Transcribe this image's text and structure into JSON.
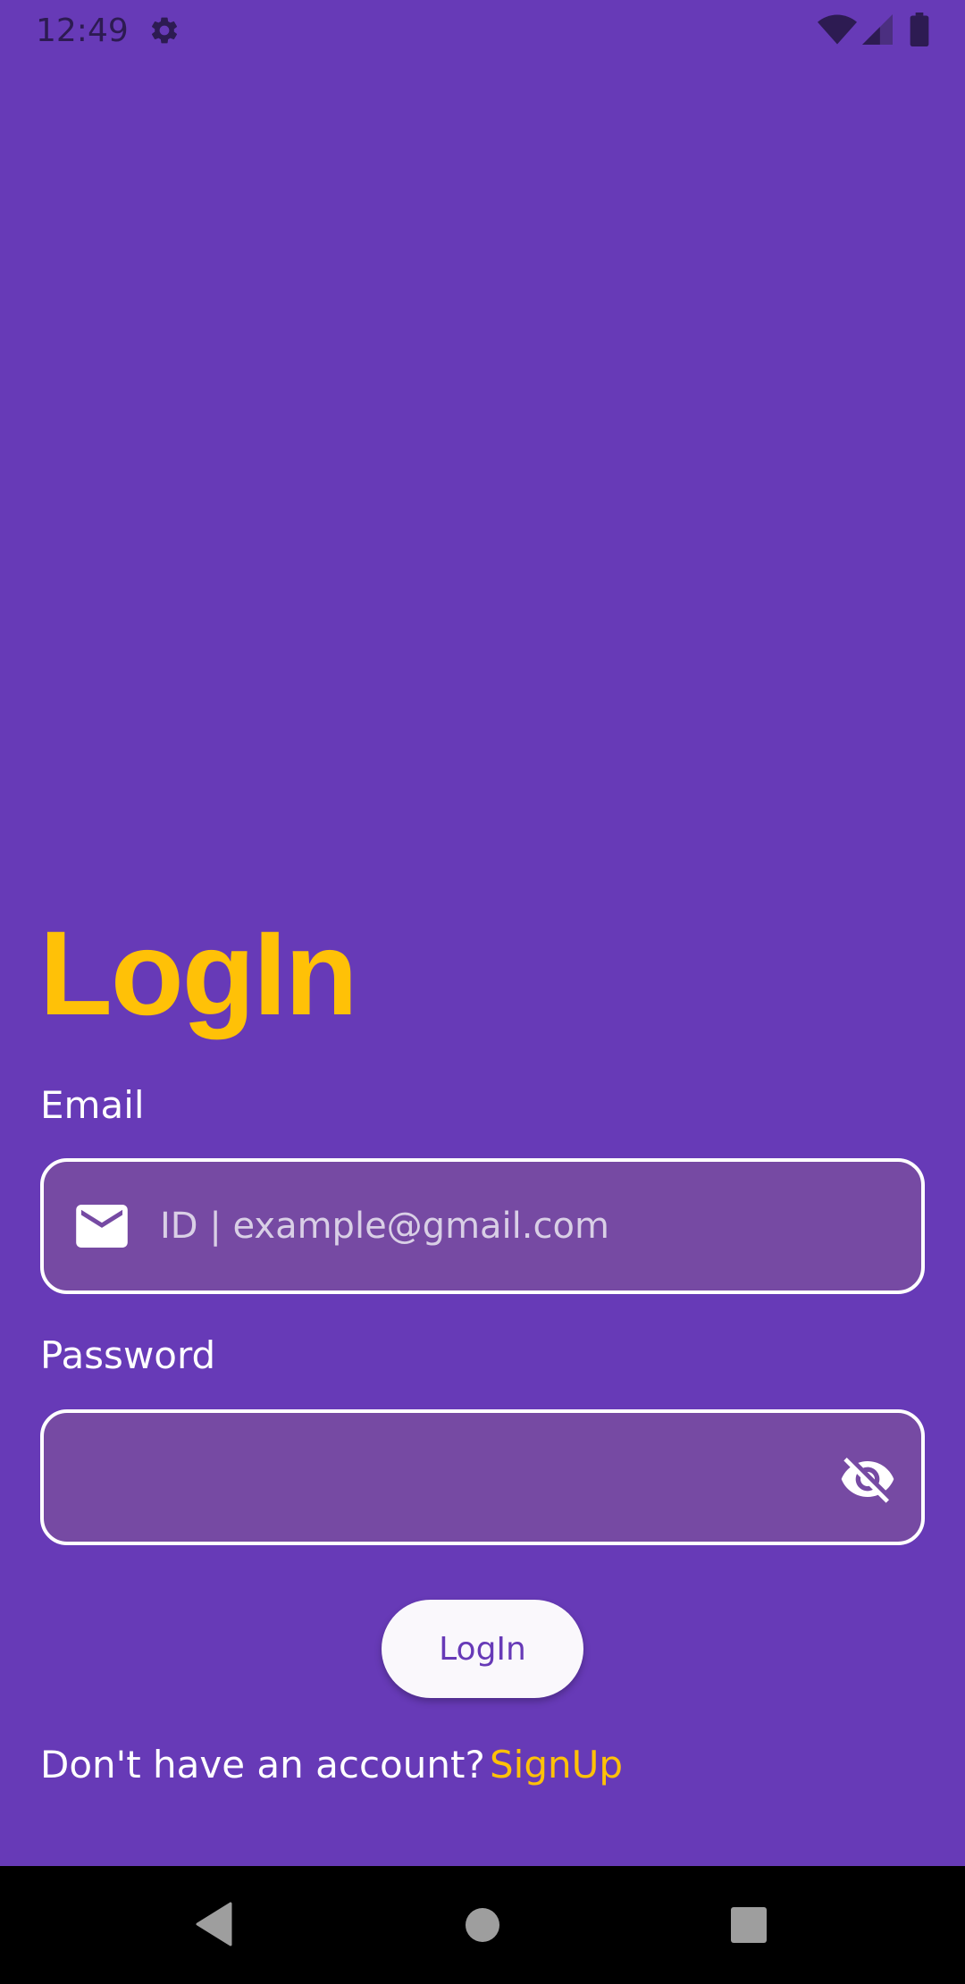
{
  "status_bar": {
    "time": "12:49",
    "icons": [
      "gear-icon",
      "wifi-icon",
      "signal-icon",
      "battery-icon"
    ]
  },
  "title": "LogIn",
  "email": {
    "label": "Email",
    "placeholder": "ID | example@gmail.com",
    "value": "",
    "icon": "mail-icon"
  },
  "password": {
    "label": "Password",
    "value": "",
    "icon": "visibility-off-icon"
  },
  "login_button": {
    "label": "LogIn"
  },
  "signup_prompt": {
    "text": "Don't have an account?",
    "link": "SignUp"
  },
  "nav_bar": {
    "icons": [
      "back-icon",
      "home-icon",
      "recents-icon"
    ]
  },
  "colors": {
    "background": "#673AB7",
    "accent": "#FFC107",
    "field_fill": "#764AA3",
    "button_fill": "#FAF8FC"
  }
}
